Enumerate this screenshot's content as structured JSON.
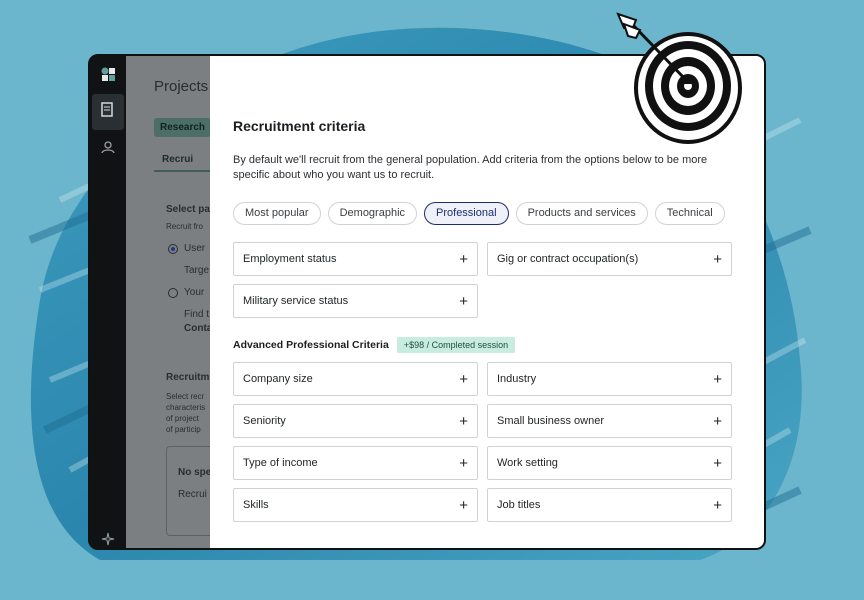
{
  "background": {
    "color": "#6bb6cc",
    "blob_color": "#2f8fb3"
  },
  "sidebar": {
    "icons": [
      "app-logo-icon",
      "document-icon",
      "user-icon",
      "sparkle-icon"
    ]
  },
  "background_app": {
    "title": "Projects",
    "chip": "Research",
    "tab": "Recrui",
    "section1_title": "Select pa",
    "section1_sub": "Recruit fro",
    "option1": "User",
    "option1_sub": "Targe",
    "option2": "Your",
    "option2_sub": "Find t",
    "option2_sub2": "Conta",
    "section2_title": "Recruitm",
    "section2_lines": [
      "Select recr",
      "characteris",
      "of project",
      "of particip"
    ],
    "box_title": "No spe",
    "box_text": "Recrui"
  },
  "modal": {
    "title": "Recruitment criteria",
    "description": "By default we'll recruit from the general population. Add criteria from the options below to be more specific about who you want us to recruit.",
    "tabs": [
      {
        "label": "Most popular",
        "active": false
      },
      {
        "label": "Demographic",
        "active": false
      },
      {
        "label": "Professional",
        "active": true
      },
      {
        "label": "Products and services",
        "active": false
      },
      {
        "label": "Technical",
        "active": false
      }
    ],
    "basic_criteria": [
      "Employment status",
      "Gig or contract occupation(s)",
      "Military service status"
    ],
    "advanced_title": "Advanced Professional Criteria",
    "advanced_badge": "+$98 / Completed session",
    "advanced_criteria": [
      "Company size",
      "Industry",
      "Seniority",
      "Small business owner",
      "Type of income",
      "Work setting",
      "Skills",
      "Job titles"
    ],
    "plus_symbol": "+"
  },
  "colors": {
    "active_tab": "#1d2f6b",
    "badge_bg": "#c9ece0"
  }
}
